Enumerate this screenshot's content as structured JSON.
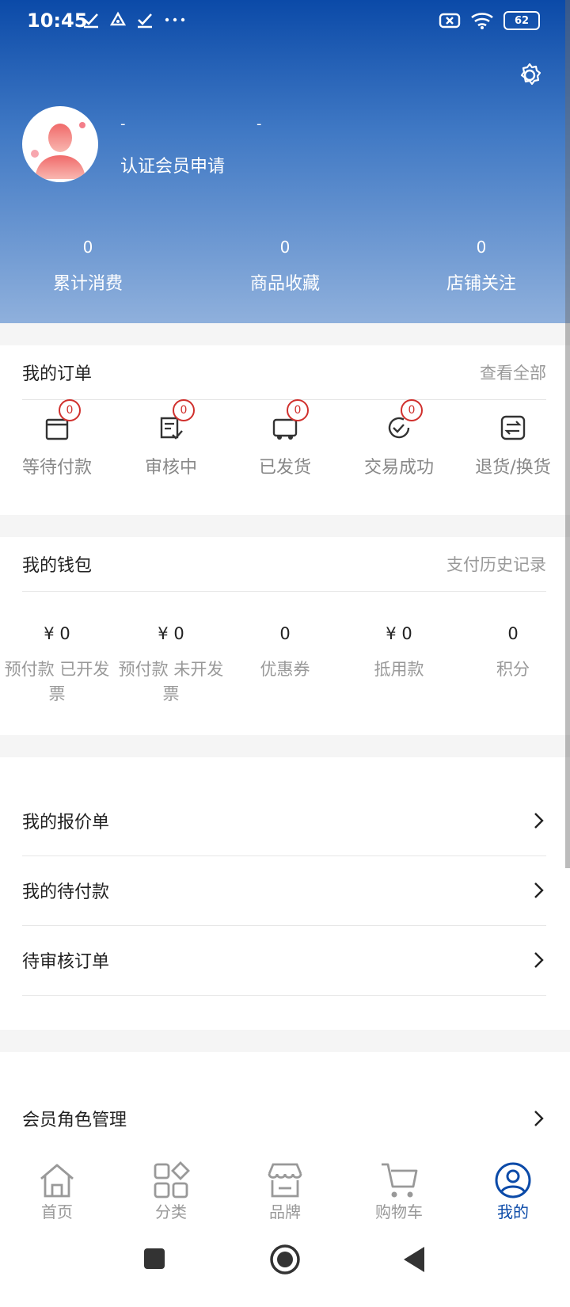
{
  "status_bar": {
    "time": "10:45",
    "battery": "62"
  },
  "profile": {
    "name_left": "-",
    "name_right": "-",
    "cert_link": "认证会员申请"
  },
  "stats": [
    {
      "value": "0",
      "label": "累计消费"
    },
    {
      "value": "0",
      "label": "商品收藏"
    },
    {
      "value": "0",
      "label": "店铺关注"
    }
  ],
  "orders": {
    "title": "我的订单",
    "view_all": "查看全部",
    "items": [
      {
        "label": "等待付款",
        "badge": "0",
        "icon": "wallet-icon"
      },
      {
        "label": "审核中",
        "badge": "0",
        "icon": "review-icon"
      },
      {
        "label": "已发货",
        "badge": "0",
        "icon": "truck-icon"
      },
      {
        "label": "交易成功",
        "badge": "0",
        "icon": "check-circle-icon"
      },
      {
        "label": "退货/换货",
        "icon": "exchange-icon"
      }
    ]
  },
  "wallet": {
    "title": "我的钱包",
    "history": "支付历史记录",
    "items": [
      {
        "value": "¥ 0",
        "label": "预付款 已开发票"
      },
      {
        "value": "¥ 0",
        "label": "预付款 未开发票"
      },
      {
        "value": "0",
        "label": "优惠券"
      },
      {
        "value": "¥ 0",
        "label": "抵用款"
      },
      {
        "value": "0",
        "label": "积分"
      }
    ]
  },
  "menu1": [
    {
      "label": "我的报价单"
    },
    {
      "label": "我的待付款"
    },
    {
      "label": "待审核订单"
    }
  ],
  "menu2": [
    {
      "label": "会员角色管理"
    }
  ],
  "tabs": [
    {
      "label": "首页",
      "icon": "home-icon"
    },
    {
      "label": "分类",
      "icon": "category-icon"
    },
    {
      "label": "品牌",
      "icon": "store-icon"
    },
    {
      "label": "购物车",
      "icon": "cart-icon"
    },
    {
      "label": "我的",
      "icon": "user-icon",
      "active": true
    }
  ],
  "colors": {
    "primary": "#0b4aa8",
    "badge": "#d0302d"
  }
}
